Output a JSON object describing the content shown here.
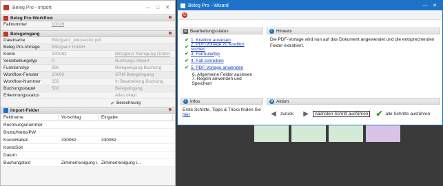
{
  "import_window": {
    "title": "Beleg Pro - Import",
    "workflow_section": "Beleg Pro-Workflow",
    "workflow_rows": [
      {
        "label": "Fallnummer",
        "value": "10026"
      }
    ],
    "eingang_section": "Belegeingang",
    "eingang_rows": [
      {
        "label": "Dateiname",
        "value": "Blitzglanz_MessoOcr.pdf",
        "extra": ""
      },
      {
        "label": "Beleg Pro-Vorlage",
        "value": "Blitzglanz GmbH",
        "extra": ""
      },
      {
        "label": "Konto",
        "value": "330062",
        "extra": "Blitzglanz Reinigung GmbH"
      },
      {
        "label": "Verarbeitungstyp",
        "value": "0",
        "extra": "Buchungs-Import"
      },
      {
        "label": "Funktionstyp",
        "value": "990",
        "extra": "Belegeingang Buchung"
      },
      {
        "label": "Workflow-Fenster",
        "value": "10600",
        "extra": "CRM Belegeingang"
      },
      {
        "label": "Workflow-Nummer",
        "value": "250",
        "extra": "In Bearbeitung Buchung"
      },
      {
        "label": "Buchungsstapel",
        "value": "500",
        "extra": "Belegeingang"
      },
      {
        "label": "Erkennungsstatus",
        "value": "",
        "extra": "Alles okay!"
      }
    ],
    "calc_label": "Berechnung",
    "felder_section": "Import-Felder",
    "felder_columns": [
      "Feldname",
      "Vorschlag",
      "Eingabe"
    ],
    "felder_rows": [
      {
        "name": "Rechnungsnummer",
        "vorschlag": "",
        "eingabe": ""
      },
      {
        "name": "Brutto/Netto/PW",
        "vorschlag": "",
        "eingabe": ""
      },
      {
        "name": "KontoHaben",
        "vorschlag": "330062",
        "eingabe": "330062"
      },
      {
        "name": "KontoSoll",
        "vorschlag": "",
        "eingabe": ""
      },
      {
        "name": "Datum",
        "vorschlag": "",
        "eingabe": ""
      },
      {
        "name": "Buchungstext",
        "vorschlag": "Zimmerreinigung i...",
        "eingabe": "Zimmerreinigung i..."
      }
    ]
  },
  "wizard_window": {
    "title": "Beleg Pro - Wizard",
    "status_section": "Bearbeitungsstatus",
    "steps": [
      {
        "text": "1. Kreditor auslesen",
        "done": true
      },
      {
        "text": "2. PDF-Vorlage zu Kreditor suchen",
        "done": true
      },
      {
        "text": "3. Formulartyp",
        "done": true
      },
      {
        "text": "4. Fall schreiben",
        "done": true
      },
      {
        "text": "5. PDF-Vorlage anwenden",
        "done": true
      },
      {
        "text": "6. Allgemeine Felder auslesen",
        "done": false
      },
      {
        "text": "7. Regeln anwenden und Speichern",
        "done": false
      }
    ],
    "hint_section": "Hinweis",
    "hint_text": "Die PDF-Vorlage wird nun auf das Dokument angewendet und die entsprechenden Felder extrahiert.",
    "infos_section": "Infos",
    "infos_text": "Erste Schritte, Tipps & Tricks finden Sie",
    "infos_link": "hier",
    "action_section": "Aktion",
    "back_label": "zurück",
    "next_label": "nächsten Schritt ausführen",
    "all_label": "alle Schritte ausführen"
  },
  "colors": {
    "wizard_titlebar": "#1e73c8",
    "check_green": "#2a9d2a",
    "link_blue": "#1a3fb5",
    "tile_green": "#d3ead6",
    "tile_purple": "#d8c3e6"
  }
}
